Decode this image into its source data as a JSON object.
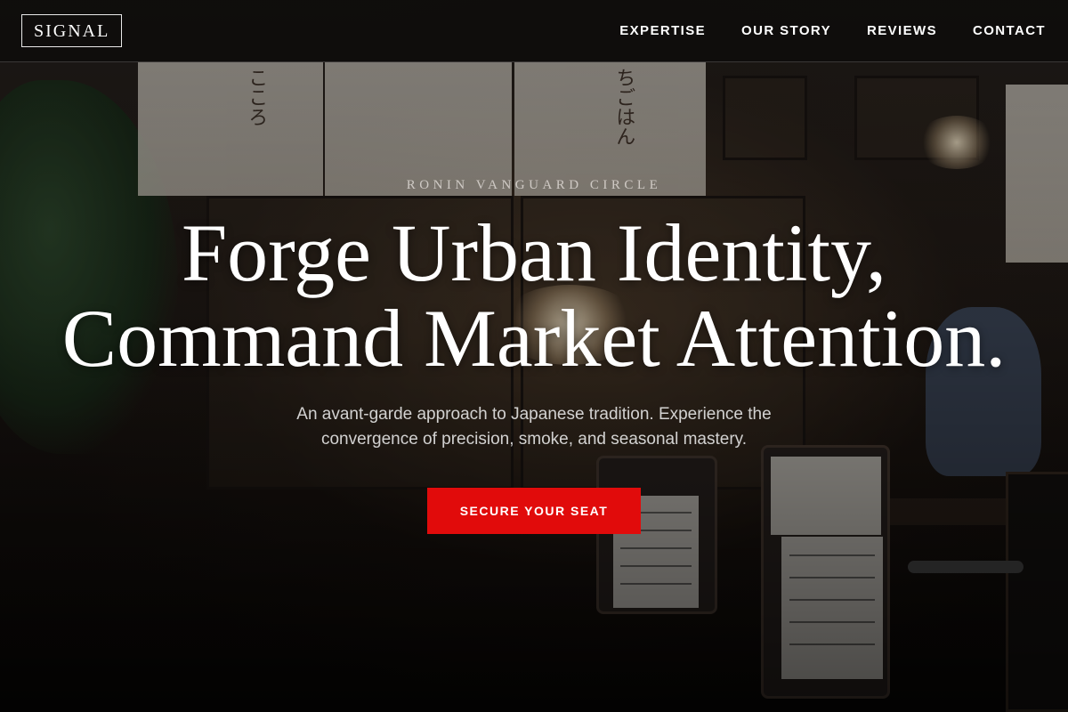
{
  "brand": {
    "logo_text": "SIGNAL"
  },
  "nav": {
    "links": [
      {
        "label": "EXPERTISE"
      },
      {
        "label": "OUR STORY"
      },
      {
        "label": "REVIEWS"
      },
      {
        "label": "CONTACT"
      }
    ]
  },
  "hero": {
    "eyebrow": "RONIN VANGUARD CIRCLE",
    "headline_line1": "Forge Urban Identity,",
    "headline_line2": "Command Market Attention.",
    "subtext": "An avant-garde approach to Japanese tradition. Experience the convergence of precision, smoke, and seasonal mastery.",
    "cta_label": "SECURE YOUR SEAT"
  },
  "colors": {
    "accent": "#e10b0b",
    "navbar_bg": "#0e0c0b",
    "text_primary": "#ffffff"
  }
}
